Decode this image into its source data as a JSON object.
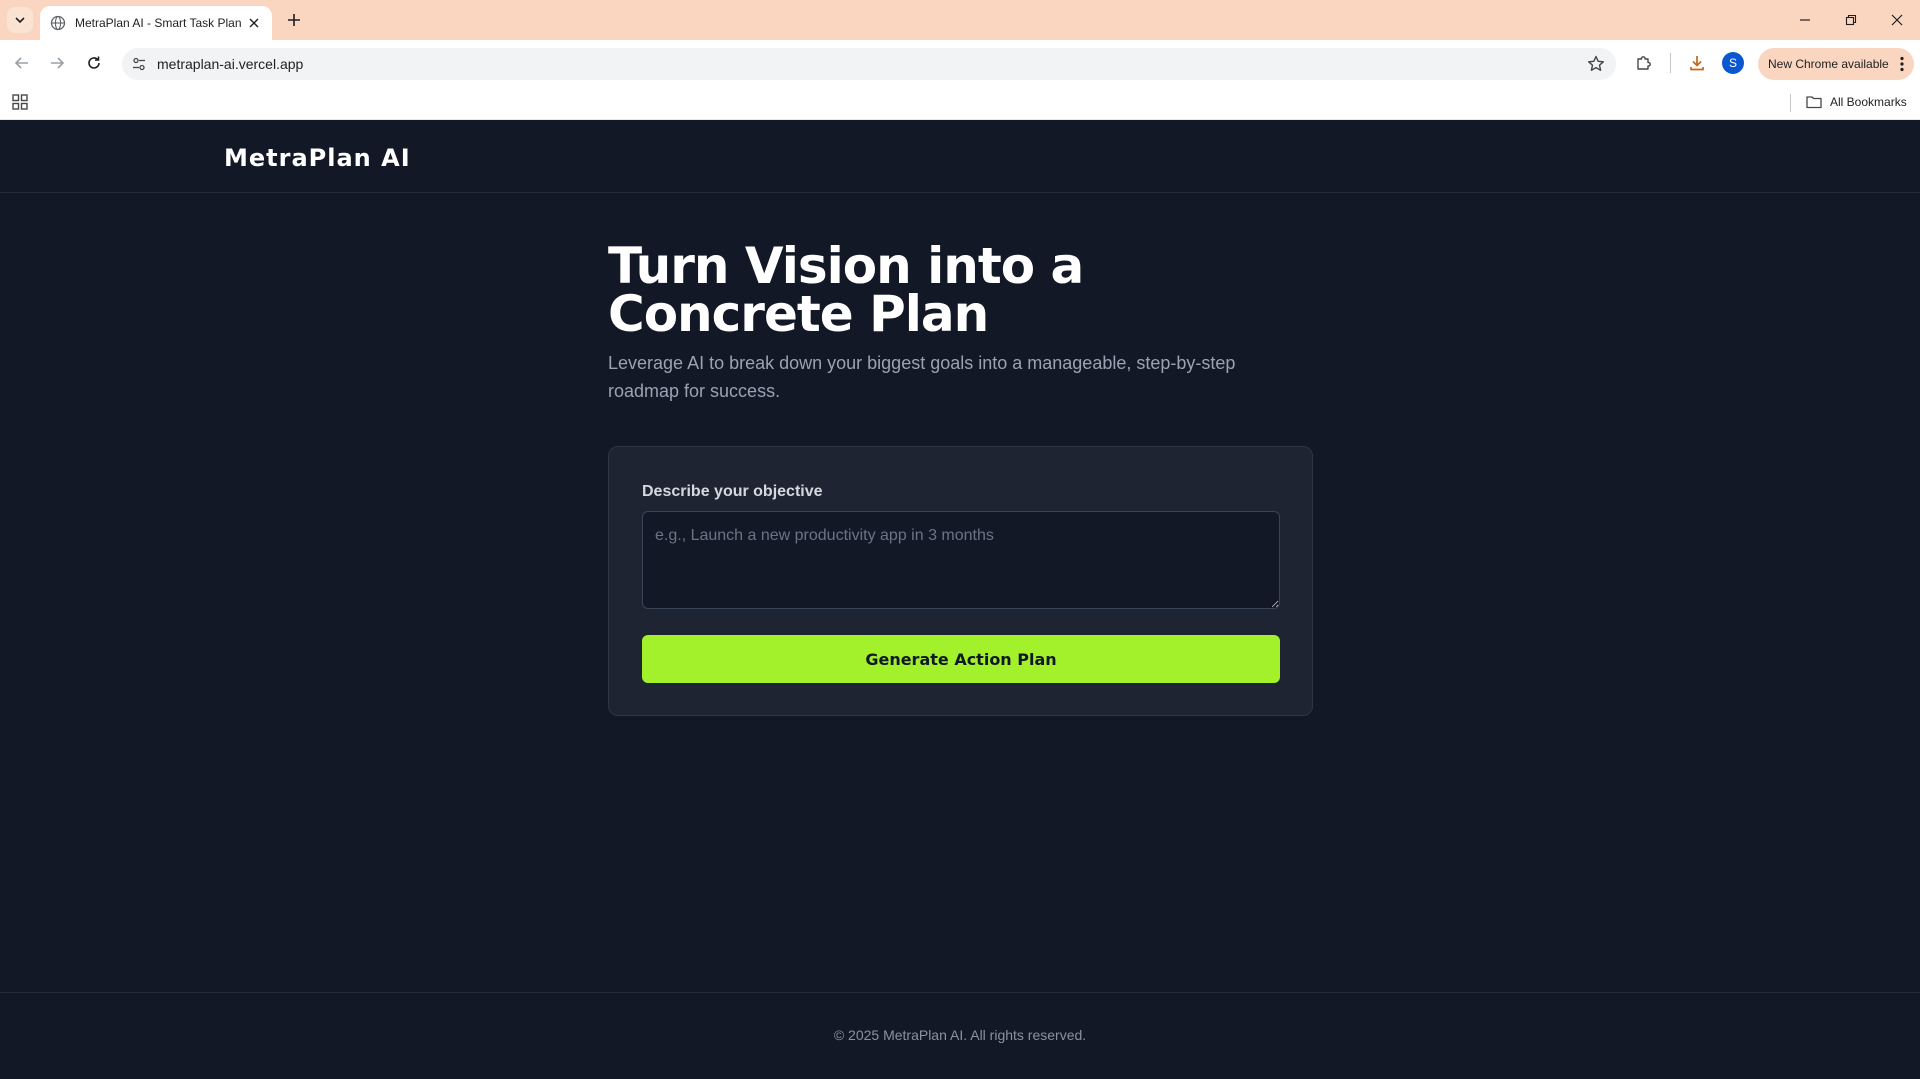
{
  "browser": {
    "tab_title": "MetraPlan AI - Smart Task Planner",
    "url": "metraplan-ai.vercel.app",
    "profile_initial": "S",
    "update_label": "New Chrome available",
    "bookmarks_label": "All Bookmarks"
  },
  "header": {
    "logo": "MetraPlan AI"
  },
  "hero": {
    "title": "Turn Vision into a Concrete Plan",
    "subtitle": "Leverage AI to break down your biggest goals into a manageable, step-by-step roadmap for success."
  },
  "form": {
    "label": "Describe your objective",
    "placeholder": "e.g., Launch a new productivity app in 3 months",
    "value": "",
    "submit_label": "Generate Action Plan"
  },
  "footer": {
    "copyright": "© 2025 MetraPlan AI. All rights reserved."
  },
  "colors": {
    "page_bg": "#121826",
    "card_bg": "#1e2432",
    "accent": "#a3f12b",
    "tabbar_bg": "#fad6c1"
  }
}
